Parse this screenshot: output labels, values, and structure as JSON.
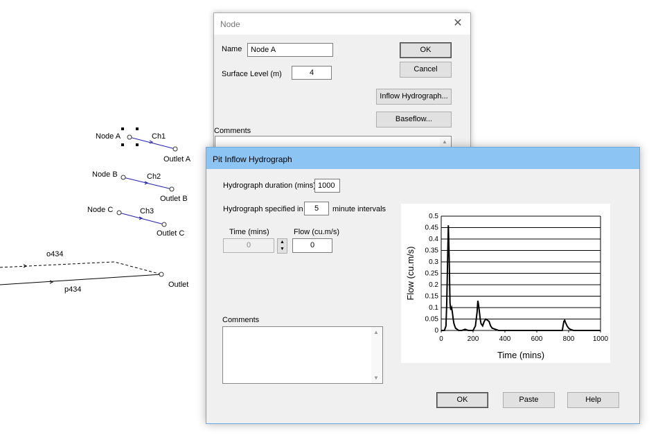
{
  "network": {
    "nodes": [
      {
        "name": "Node A",
        "channel": "Ch1",
        "outlet": "Outlet A"
      },
      {
        "name": "Node B",
        "channel": "Ch2",
        "outlet": "Outlet B"
      },
      {
        "name": "Node C",
        "channel": "Ch3",
        "outlet": "Outlet C"
      }
    ],
    "link_dashed": "o434",
    "link_solid": "p434",
    "outlet": "Outlet",
    "link_color": "#1f1fb4"
  },
  "node_dialog": {
    "title": "Node",
    "name_label": "Name",
    "name_value": "Node A",
    "surface_label": "Surface Level (m)",
    "surface_value": "4",
    "ok": "OK",
    "cancel": "Cancel",
    "inflow_button": "Inflow Hydrograph...",
    "baseflow_button": "Baseflow...",
    "comments_label": "Comments"
  },
  "pit_dialog": {
    "title": "Pit Inflow Hydrograph",
    "duration_label": "Hydrograph duration (mins)",
    "duration_value": "1000",
    "specified_label": "Hydrograph specified in",
    "interval_value": "5",
    "interval_suffix": "minute intervals",
    "time_col_label": "Time (mins)",
    "flow_col_label": "Flow (cu.m/s)",
    "time_value": "0",
    "flow_value": "0",
    "comments_label": "Comments",
    "ok": "OK",
    "paste": "Paste",
    "help": "Help",
    "titlebar_color": "#8cc4f4"
  },
  "chart_data": {
    "type": "line",
    "xlabel": "Time (mins)",
    "ylabel": "Flow (cu.m/s)",
    "xlim": [
      0,
      1000
    ],
    "ylim": [
      0,
      0.5
    ],
    "xticks": [
      "0",
      "200",
      "400",
      "600",
      "800",
      "1000"
    ],
    "yticks": [
      "0",
      "0.05",
      "0.1",
      "0.15",
      "0.2",
      "0.25",
      "0.3",
      "0.35",
      "0.4",
      "0.45",
      "0.5"
    ],
    "grid": "horizontal",
    "series": [
      {
        "x": [
          0,
          20,
          30,
          35,
          40,
          45,
          50,
          55,
          60,
          65,
          70,
          75,
          80,
          85,
          90,
          100,
          110,
          130,
          150,
          170,
          200,
          215,
          225,
          230,
          235,
          240,
          245,
          250,
          260,
          270,
          280,
          290,
          300,
          310,
          320,
          340,
          360,
          400,
          740,
          760,
          770,
          775,
          780,
          790,
          800,
          810,
          830,
          850,
          1000
        ],
        "y": [
          0,
          0,
          0.02,
          0.12,
          0.3,
          0.46,
          0.32,
          0.12,
          0.09,
          0.1,
          0.08,
          0.05,
          0.03,
          0.02,
          0.01,
          0.005,
          0,
          0,
          0.005,
          0,
          0,
          0.02,
          0.08,
          0.13,
          0.11,
          0.08,
          0.05,
          0.03,
          0.02,
          0.04,
          0.05,
          0.045,
          0.04,
          0.02,
          0.01,
          0.005,
          0,
          0,
          0,
          0,
          0.04,
          0.045,
          0.035,
          0.02,
          0.01,
          0.005,
          0,
          0,
          0
        ]
      }
    ]
  }
}
